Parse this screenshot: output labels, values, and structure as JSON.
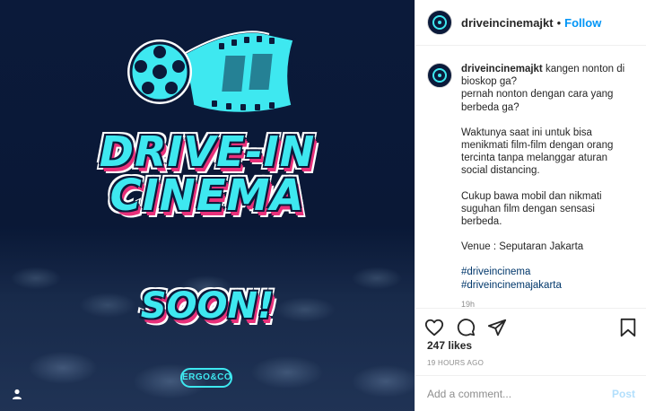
{
  "post_image": {
    "title_line_1": "DRIVE-IN",
    "title_line_2": "CINEMA",
    "subtitle": "SOON!",
    "brand": "ERGO&CO",
    "accent_color": "#3ee8f0",
    "shadow_color": "#e8307a",
    "user_tag_icon": "person-icon"
  },
  "header": {
    "username": "driveincinemajkt",
    "separator": "•",
    "follow_label": "Follow"
  },
  "caption": {
    "username": "driveincinemajkt",
    "lines_1": [
      "kangen nonton di bioskop ga?",
      "pernah nonton dengan cara yang berbeda ga?"
    ],
    "paragraph_2": "Waktunya saat ini untuk bisa menikmati film-film dengan orang tercinta tanpa melanggar aturan social distancing.",
    "paragraph_3": "Cukup bawa mobil dan nikmati suguhan film dengan sensasi berbeda.",
    "venue": "Venue : Seputaran Jakarta",
    "hashtags": [
      "#driveincinema",
      "#driveincinemajakarta"
    ],
    "time": "19h"
  },
  "actions": {
    "like_icon": "heart-icon",
    "comment_icon": "comment-icon",
    "share_icon": "paper-plane-icon",
    "save_icon": "bookmark-icon"
  },
  "likes": "247 likes",
  "timestamp": "19 HOURS AGO",
  "comment_box": {
    "placeholder": "Add a comment...",
    "post_label": "Post"
  }
}
